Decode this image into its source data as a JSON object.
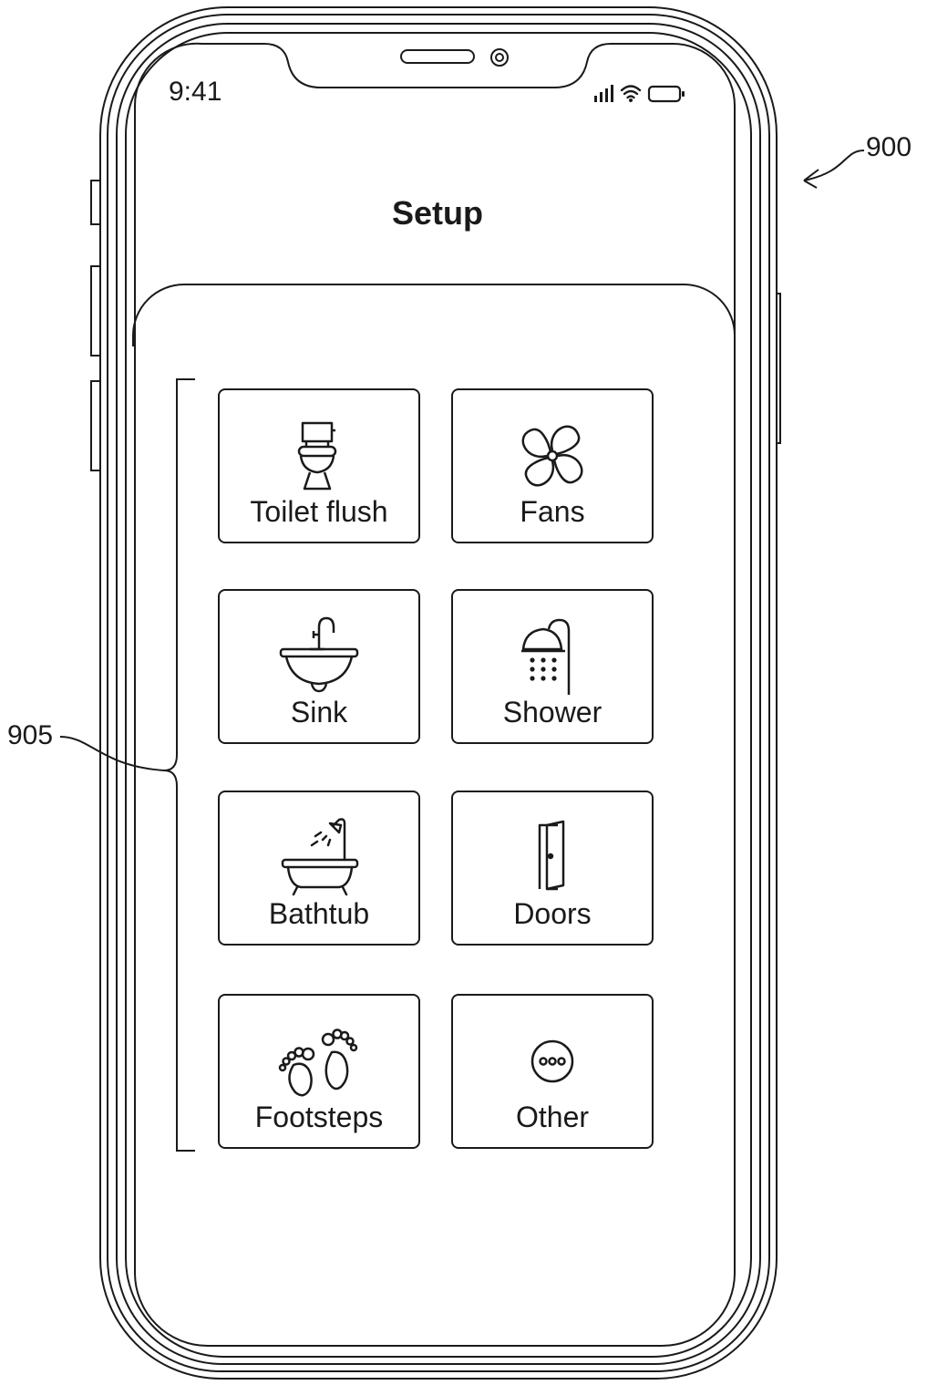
{
  "status": {
    "time": "9:41"
  },
  "header": {
    "title": "Setup"
  },
  "references": {
    "device": "900",
    "grid": "905"
  },
  "tiles": [
    {
      "label": "Toilet flush",
      "icon": "toilet-icon"
    },
    {
      "label": "Fans",
      "icon": "fan-icon"
    },
    {
      "label": "Sink",
      "icon": "sink-icon"
    },
    {
      "label": "Shower",
      "icon": "shower-icon"
    },
    {
      "label": "Bathtub",
      "icon": "bathtub-icon"
    },
    {
      "label": "Doors",
      "icon": "door-icon"
    },
    {
      "label": "Footsteps",
      "icon": "footsteps-icon"
    },
    {
      "label": "Other",
      "icon": "more-icon"
    }
  ]
}
